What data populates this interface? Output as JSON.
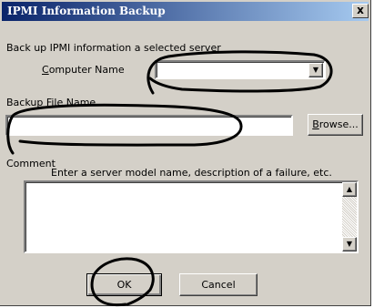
{
  "window": {
    "title": "IPMI Information Backup",
    "close_glyph": "x"
  },
  "intro": "Back up IPMI information a selected server",
  "computer_name": {
    "label_first": "C",
    "label_rest": "omputer Name",
    "value": "",
    "arrow_icon": "dropdown-arrow-icon"
  },
  "backup_file": {
    "label": "Backup File Name",
    "value": "",
    "browse_first": "B",
    "browse_rest": "rowse..."
  },
  "comment": {
    "label": "Comment",
    "hint": "Enter a server model name, description of a failure, etc.",
    "value": ""
  },
  "buttons": {
    "ok": "OK",
    "cancel": "Cancel"
  },
  "colors": {
    "title_start": "#0a246a",
    "title_end": "#a6caf0",
    "face": "#d4d0c8",
    "annotation": "#000000"
  }
}
